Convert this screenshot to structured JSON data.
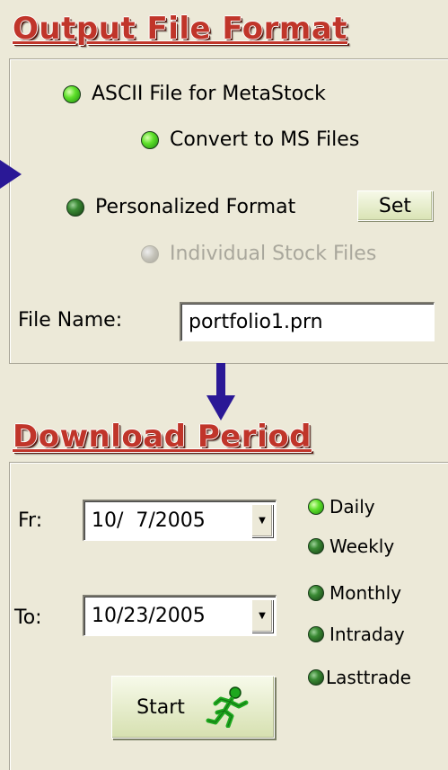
{
  "output": {
    "title": "Output File Format",
    "ascii_label": "ASCII File for MetaStock",
    "convert_label": "Convert to MS Files",
    "personalized_label": "Personalized Format",
    "set_button": "Set",
    "individual_label": "Individual Stock Files",
    "filename_label": "File Name:",
    "filename_value": "portfolio1.prn"
  },
  "download": {
    "title": "Download Period",
    "from_label": "Fr:",
    "from_value": "10/  7/2005",
    "to_label": "To:",
    "to_value": "10/23/2005",
    "start_button": "Start",
    "periods": [
      "Daily",
      "Weekly",
      "Monthly",
      "Intraday",
      "Lasttrade"
    ]
  },
  "colors": {
    "title_red": "#c0352a",
    "radio_selected": "#5ee02a",
    "radio_unselected": "#3a8a34",
    "arrow_purple": "#2a1896"
  }
}
